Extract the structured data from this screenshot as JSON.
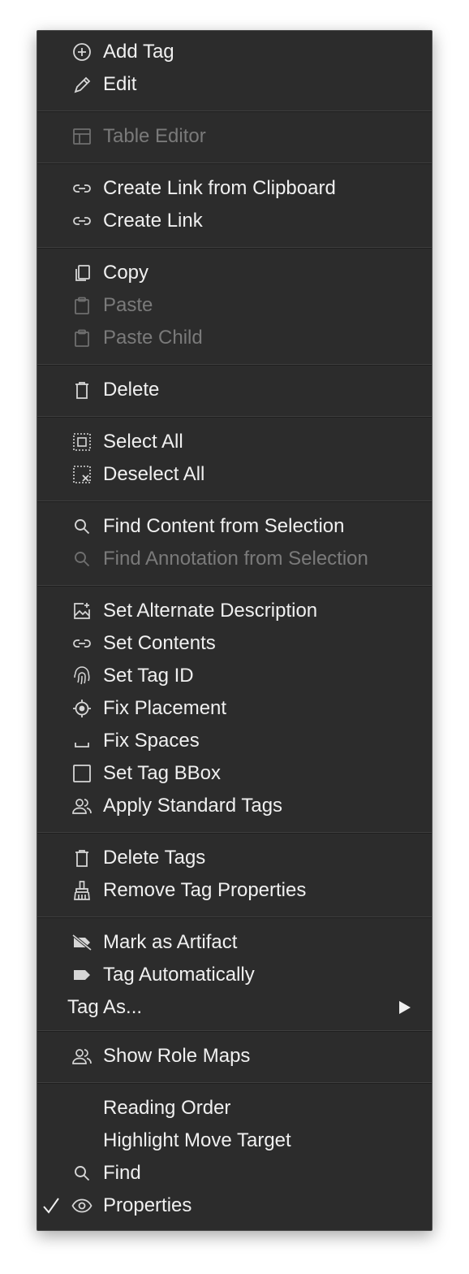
{
  "menu": {
    "items": [
      {
        "label": "Add Tag",
        "icon": "plus-circle-icon"
      },
      {
        "label": "Edit",
        "icon": "pencil-icon"
      },
      {
        "label": "Table Editor",
        "icon": "table-icon",
        "disabled": true
      },
      {
        "label": "Create Link from Clipboard",
        "icon": "link-icon"
      },
      {
        "label": "Create Link",
        "icon": "link-icon"
      },
      {
        "label": "Copy",
        "icon": "copy-icon"
      },
      {
        "label": "Paste",
        "icon": "clipboard-icon",
        "disabled": true
      },
      {
        "label": "Paste Child",
        "icon": "clipboard-icon",
        "disabled": true
      },
      {
        "label": "Delete",
        "icon": "trash-icon"
      },
      {
        "label": "Select All",
        "icon": "select-all-icon"
      },
      {
        "label": "Deselect All",
        "icon": "deselect-icon"
      },
      {
        "label": "Find Content from Selection",
        "icon": "search-icon"
      },
      {
        "label": "Find Annotation from Selection",
        "icon": "search-icon",
        "disabled": true
      },
      {
        "label": "Set Alternate Description",
        "icon": "image-add-icon"
      },
      {
        "label": "Set Contents",
        "icon": "link-icon"
      },
      {
        "label": "Set Tag ID",
        "icon": "fingerprint-icon"
      },
      {
        "label": "Fix Placement",
        "icon": "target-icon"
      },
      {
        "label": "Fix Spaces",
        "icon": "space-icon"
      },
      {
        "label": "Set Tag BBox",
        "icon": "square-icon"
      },
      {
        "label": "Apply Standard Tags",
        "icon": "users-icon"
      },
      {
        "label": "Delete Tags",
        "icon": "trash-icon"
      },
      {
        "label": "Remove Tag Properties",
        "icon": "broom-icon"
      },
      {
        "label": "Mark as Artifact",
        "icon": "tag-off-icon"
      },
      {
        "label": "Tag Automatically",
        "icon": "tag-icon"
      },
      {
        "label": "Tag As...",
        "icon": "",
        "submenu": true
      },
      {
        "label": "Show Role Maps",
        "icon": "users-icon"
      },
      {
        "label": "Reading Order",
        "icon": ""
      },
      {
        "label": "Highlight Move Target",
        "icon": ""
      },
      {
        "label": "Find",
        "icon": "search-icon"
      },
      {
        "label": "Properties",
        "icon": "eye-icon",
        "checked": true
      }
    ],
    "submenu_arrow": "▶",
    "check_mark": "✓"
  }
}
